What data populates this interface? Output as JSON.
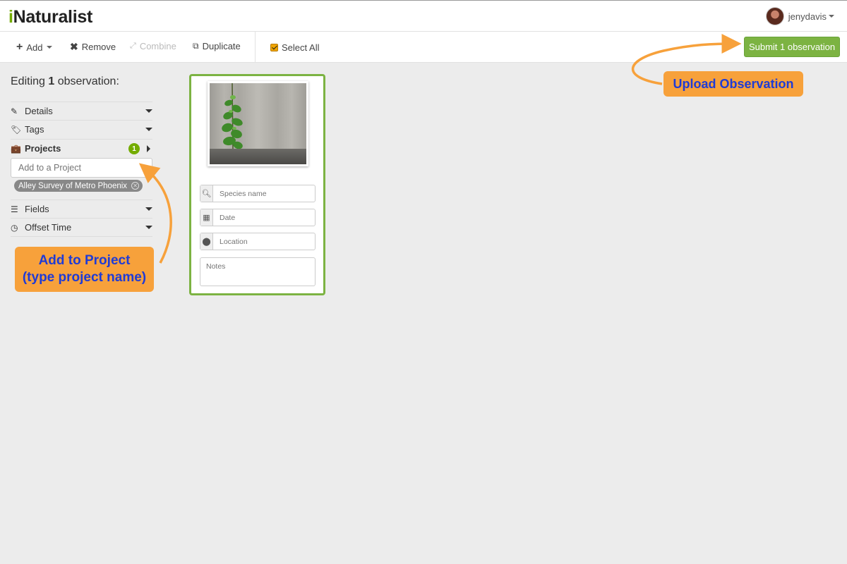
{
  "header": {
    "logo_prefix": "i",
    "logo_rest": "Naturalist",
    "username": "jenydavis"
  },
  "toolbar": {
    "add_label": "Add",
    "remove_label": "Remove",
    "combine_label": "Combine",
    "duplicate_label": "Duplicate",
    "select_all_label": "Select All",
    "select_all_checked": true,
    "submit_label": "Submit 1 observation"
  },
  "sidebar": {
    "editing_prefix": "Editing",
    "editing_count": "1",
    "editing_suffix": "observation:",
    "sections": {
      "details": "Details",
      "tags": "Tags",
      "projects": "Projects",
      "projects_count": "1",
      "fields": "Fields",
      "offset_time": "Offset Time"
    },
    "project_input_placeholder": "Add to a Project",
    "project_tag": "Alley Survey of Metro Phoenix"
  },
  "card": {
    "species_placeholder": "Species name",
    "date_placeholder": "Date",
    "location_placeholder": "Location",
    "notes_placeholder": "Notes"
  },
  "callouts": {
    "upload": "Upload Observation",
    "project_line1": "Add to Project",
    "project_line2": "(type project name)"
  },
  "colors": {
    "brand_green": "#74ac00",
    "submit_green": "#7cb342",
    "callout_orange": "#f7a13b",
    "callout_text": "#1f3bd6"
  },
  "icons": {
    "add": "plus-icon",
    "remove": "x-icon",
    "combine": "combine-icon",
    "duplicate": "duplicate-icon",
    "details": "pencil-icon",
    "tags": "tag-icon",
    "projects": "briefcase-icon",
    "fields": "list-icon",
    "offset_time": "clock-icon",
    "species": "search-icon",
    "date": "calendar-icon",
    "location": "map-pin-icon"
  }
}
